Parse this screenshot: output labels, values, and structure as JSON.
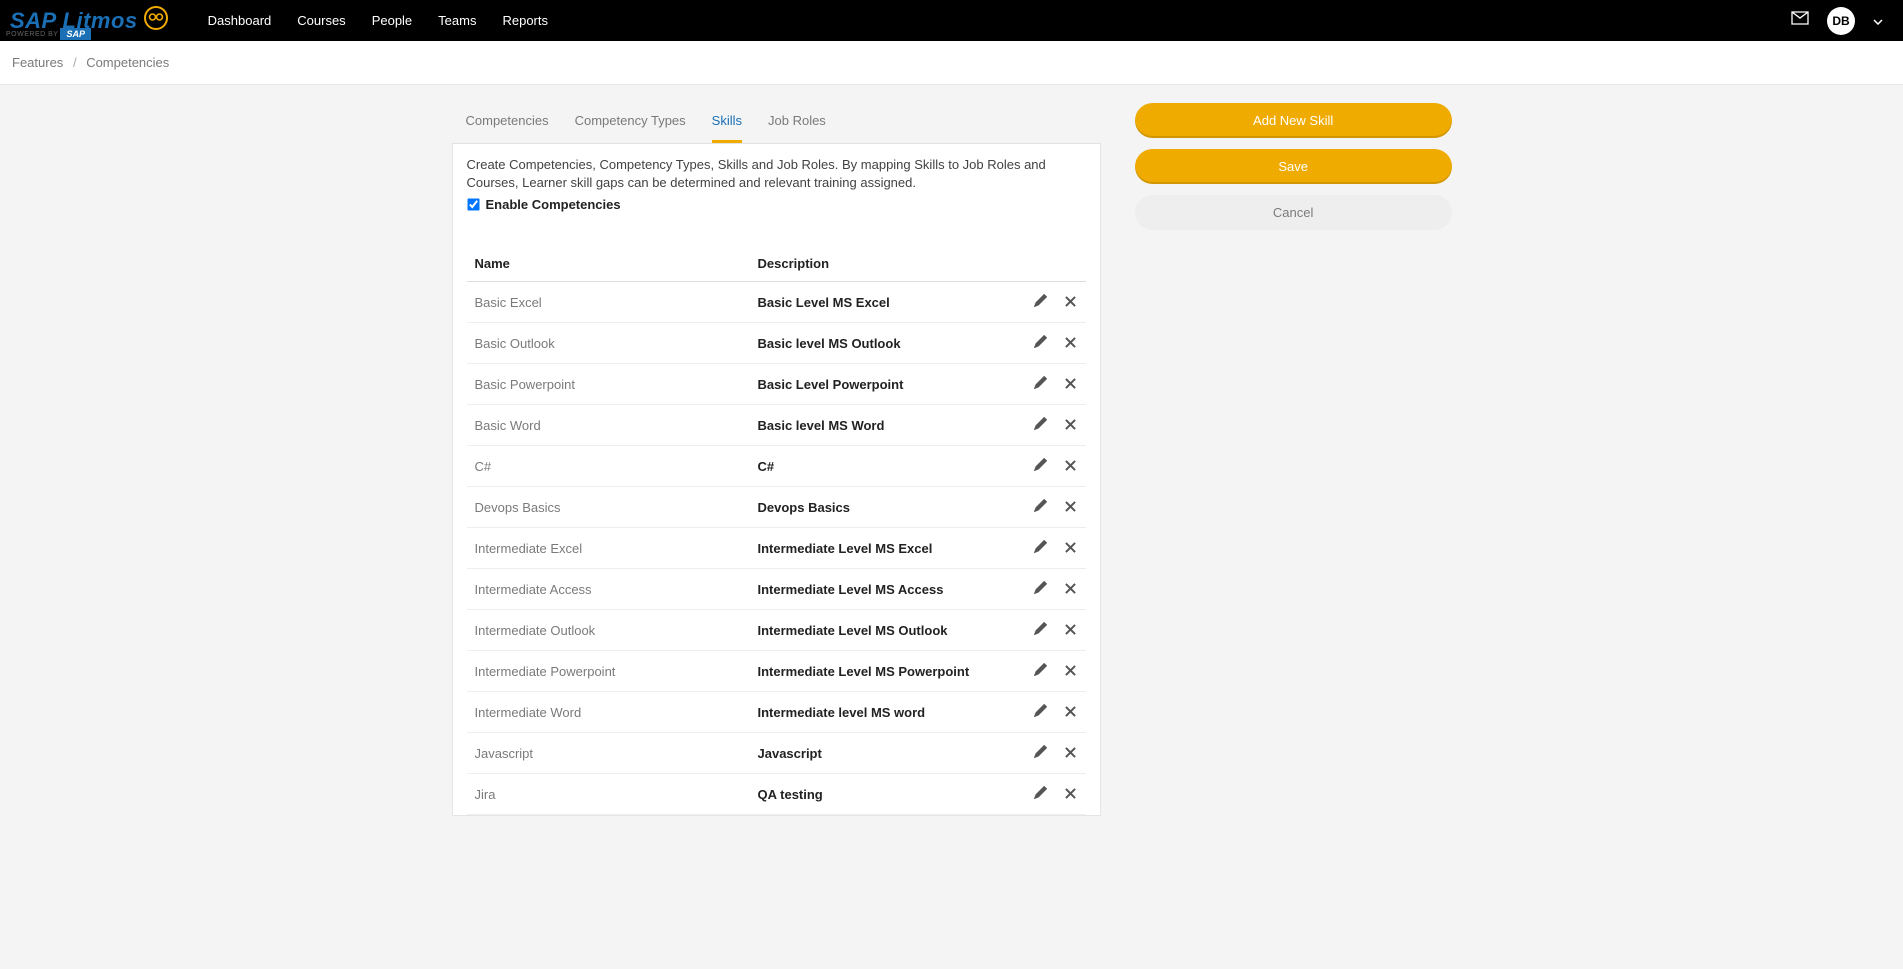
{
  "brand": {
    "name": "SAP Litmos",
    "powered": "POWERED BY",
    "sap": "SAP"
  },
  "nav": {
    "items": [
      "Dashboard",
      "Courses",
      "People",
      "Teams",
      "Reports"
    ],
    "avatar": "DB"
  },
  "breadcrumb": {
    "root": "Features",
    "current": "Competencies"
  },
  "tabs": [
    "Competencies",
    "Competency Types",
    "Skills",
    "Job Roles"
  ],
  "active_tab": "Skills",
  "intro": "Create Competencies, Competency Types, Skills and Job Roles. By mapping Skills to Job Roles and Courses, Learner skill gaps can be determined and relevant training assigned.",
  "enable_label": "Enable Competencies",
  "enable_checked": true,
  "table": {
    "headers": {
      "name": "Name",
      "description": "Description"
    },
    "rows": [
      {
        "name": "Basic Excel",
        "description": "Basic Level MS Excel"
      },
      {
        "name": "Basic Outlook",
        "description": "Basic level MS Outlook"
      },
      {
        "name": "Basic Powerpoint",
        "description": "Basic Level Powerpoint"
      },
      {
        "name": "Basic Word",
        "description": "Basic level MS Word"
      },
      {
        "name": "C#",
        "description": "C#"
      },
      {
        "name": "Devops Basics",
        "description": "Devops Basics"
      },
      {
        "name": "Intermediate Excel",
        "description": "Intermediate Level MS Excel"
      },
      {
        "name": "Intermediate Access",
        "description": "Intermediate Level MS Access"
      },
      {
        "name": "Intermediate Outlook",
        "description": "Intermediate Level MS Outlook"
      },
      {
        "name": "Intermediate Powerpoint",
        "description": "Intermediate Level MS Powerpoint"
      },
      {
        "name": "Intermediate Word",
        "description": "Intermediate level MS word"
      },
      {
        "name": "Javascript",
        "description": "Javascript"
      },
      {
        "name": "Jira",
        "description": "QA testing"
      }
    ]
  },
  "buttons": {
    "add": "Add New Skill",
    "save": "Save",
    "cancel": "Cancel"
  }
}
